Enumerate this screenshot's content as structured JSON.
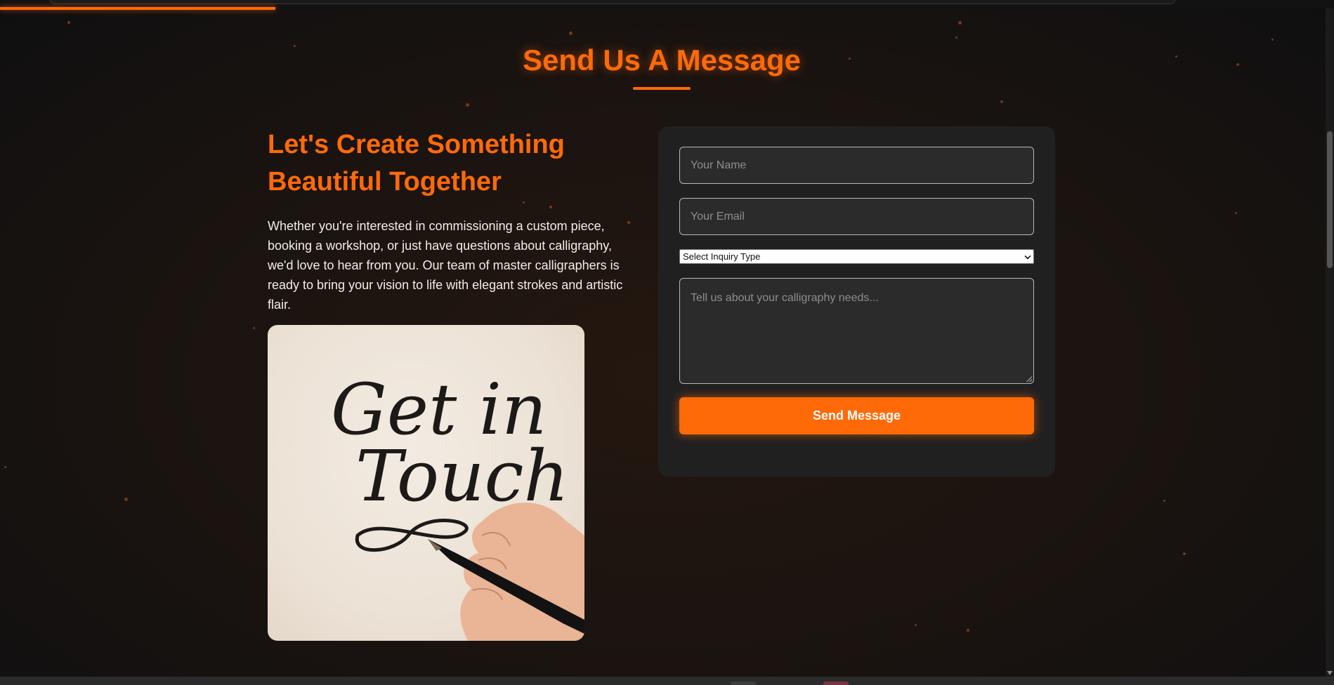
{
  "section": {
    "title": "Send Us A Message"
  },
  "intro": {
    "heading_line1": "Let's Create Something",
    "heading_line2": "Beautiful Together",
    "body": "Whether you're interested in commissioning a custom piece, booking a workshop, or just have questions about calligraphy, we'd love to hear from you. Our team of master calligraphers is ready to bring your vision to life with elegant strokes and artistic flair."
  },
  "image": {
    "lettering_line1": "Get in",
    "lettering_line2": "Touch"
  },
  "form": {
    "name_placeholder": "Your Name",
    "email_placeholder": "Your Email",
    "inquiry_selected": "Select Inquiry Type",
    "message_placeholder": "Tell us about your calligraphy needs...",
    "submit_label": "Send Message"
  },
  "colors": {
    "accent": "#ff6a08",
    "background": "#1c1410",
    "card": "#212020",
    "field": "#2c2b2b"
  }
}
